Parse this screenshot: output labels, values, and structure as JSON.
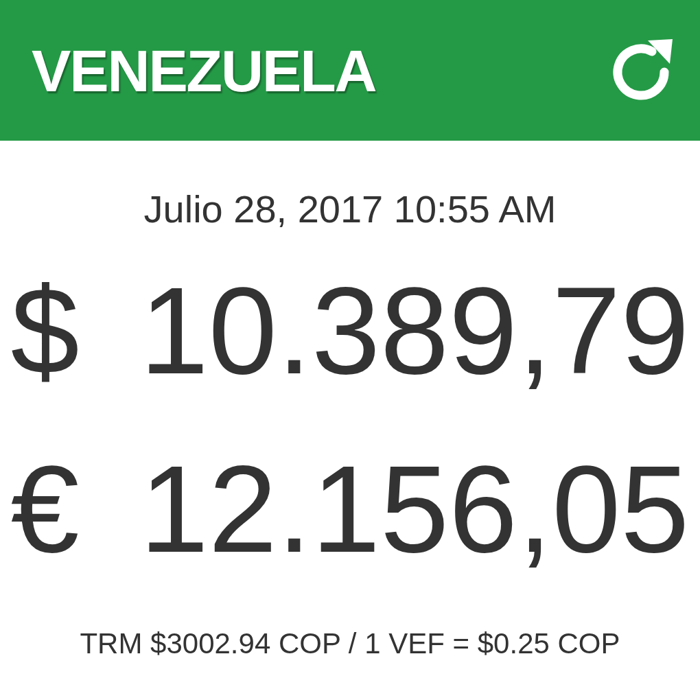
{
  "header": {
    "title": "VENEZUELA"
  },
  "date": "Julio 28, 2017 10:55 AM",
  "rates": [
    {
      "symbol": "$",
      "amount": "10.389,79"
    },
    {
      "symbol": "€",
      "amount": "12.156,05"
    }
  ],
  "note": "TRM $3002.94 COP / 1 VEF = $0.25 COP"
}
